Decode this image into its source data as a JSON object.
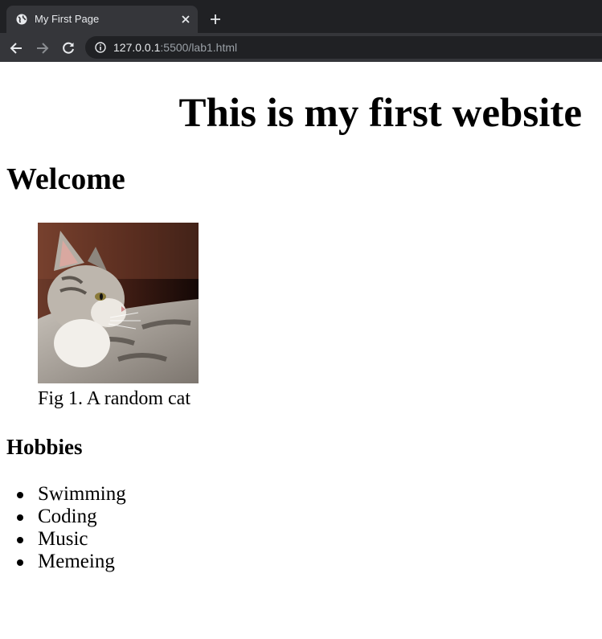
{
  "browser": {
    "tab_title": "My First Page",
    "url_host": "127.0.0.1",
    "url_rest": ":5500/lab1.html",
    "colors": {
      "tabstrip": "#202124",
      "toolbar": "#35363a",
      "omnibox": "#202124"
    }
  },
  "page": {
    "title": "This is my first website",
    "welcome": "Welcome",
    "figure_caption": "Fig 1. A random cat",
    "hobbies_heading": "Hobbies",
    "hobbies": [
      "Swimming",
      "Coding",
      "Music",
      "Memeing"
    ]
  }
}
